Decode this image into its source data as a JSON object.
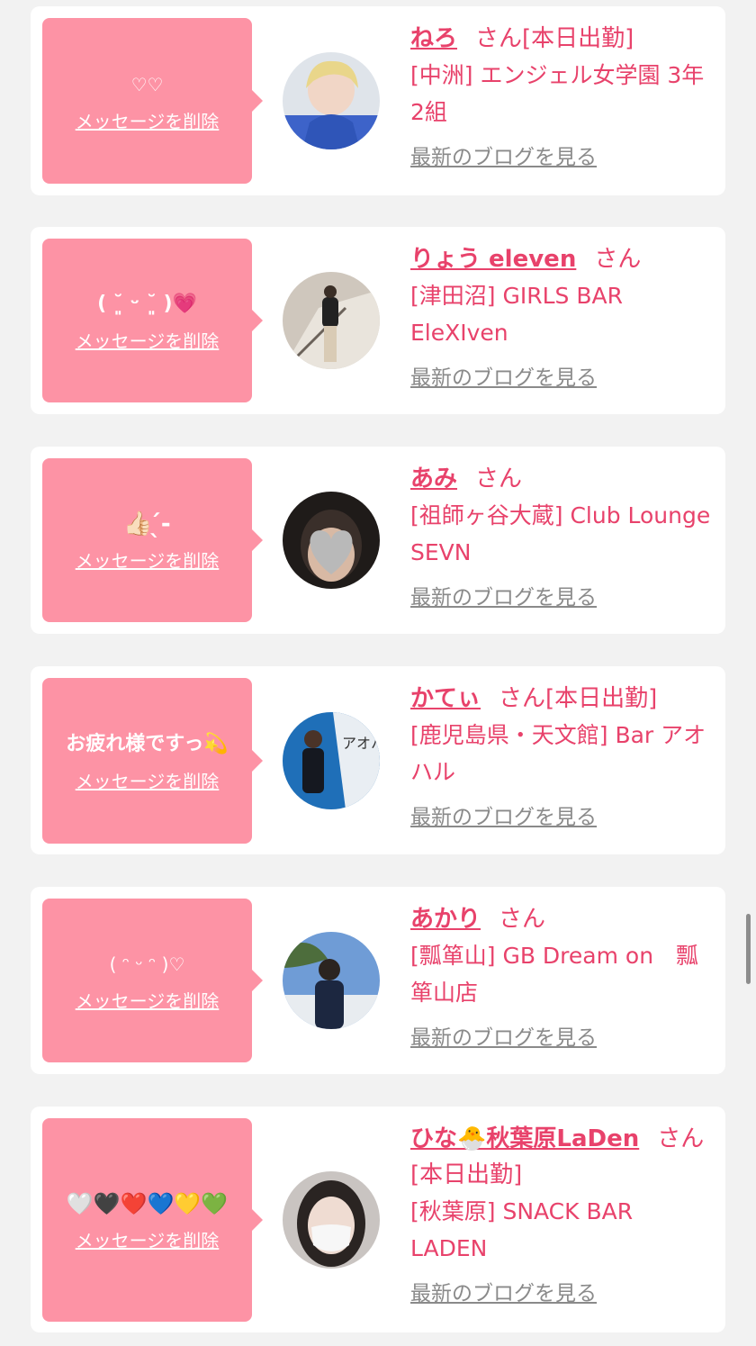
{
  "labels": {
    "delete": "メッセージを削除",
    "blog": "最新のブログを見る",
    "san": "さん"
  },
  "cards": [
    {
      "message": "♡♡",
      "name": "ねろ",
      "status": "[本日出勤]",
      "shop": "[中洲] エンジェル女学園 3年2組",
      "avatar": "blond-person-blue-jacket"
    },
    {
      "message": "( ˘͈ ᵕ ˘͈ )💗",
      "name": "りょう eleven",
      "status": "",
      "shop": "[津田沼] GIRLS BAR EleXIven",
      "avatar": "person-standing-stairs"
    },
    {
      "message": "👍🏻 ̖́-",
      "name": "あみ",
      "status": "",
      "shop": "[祖師ヶ谷大蔵] Club Lounge SEVN",
      "avatar": "face-covered-by-heart"
    },
    {
      "message": "お疲れ様ですっ💫",
      "name": "かてぃ",
      "status": "[本日出勤]",
      "shop": "[鹿児島県・天文館] Bar アオハル",
      "avatar": "person-blue-wall"
    },
    {
      "message": "( ᵔ ᵕ ᵔ )♡",
      "name": "あかり",
      "status": "",
      "shop": "[瓢箪山] GB Dream on　瓢箪山店",
      "avatar": "person-outdoor-sky"
    },
    {
      "message": "🤍🖤❤️💙💛💚",
      "name": "ひな🐣秋葉原LaDen",
      "status": "[本日出勤]",
      "shop": "[秋葉原] SNACK BAR LADEN",
      "avatar": "person-white-mask"
    }
  ],
  "colors": {
    "accent": "#e8426b",
    "bubble": "#fd93a5",
    "background": "#f2f2f2",
    "link_gray": "#8a8a8a"
  }
}
